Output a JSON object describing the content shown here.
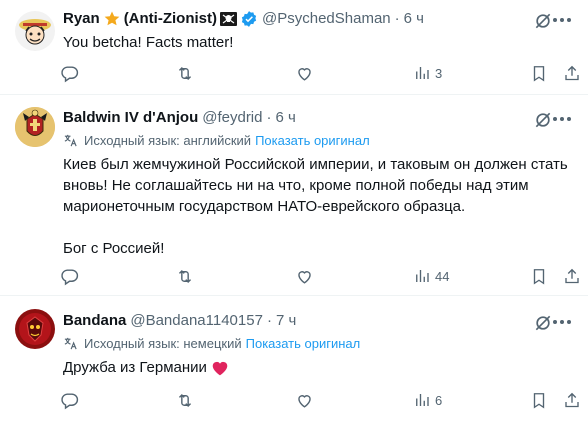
{
  "tweets": [
    {
      "name": "Ryan",
      "name_suffix": "(Anti-Zionist)",
      "handle": "@PsychedShaman",
      "time": "6 ч",
      "body": [
        "You betcha! Facts matter!"
      ],
      "counts": {
        "replies": "",
        "retweets": "",
        "likes": "",
        "views": "3"
      }
    },
    {
      "name": "Baldwin IV d'Anjou",
      "handle": "@feydrid",
      "time": "6 ч",
      "translation_label": "Исходный язык: английский",
      "translation_action": "Показать оригинал",
      "body": [
        "Киев был жемчужиной Российской империи, и таковым он должен стать вновь! Не соглашайтесь ни на что, кроме полной победы над этим марионеточным государством НАТО-еврейского образца.",
        "Бог с Россией!"
      ],
      "counts": {
        "replies": "",
        "retweets": "",
        "likes": "",
        "views": "44"
      }
    },
    {
      "name": "Bandana",
      "handle": "@Bandana1140157",
      "time": "7 ч",
      "translation_label": "Исходный язык: немецкий",
      "translation_action": "Показать оригинал",
      "body": [
        "Дружба из Германии"
      ],
      "counts": {
        "replies": "",
        "retweets": "",
        "likes": "",
        "views": "6"
      }
    }
  ],
  "separator": "·",
  "icons": {
    "reply": "reply-icon",
    "retweet": "retweet-icon",
    "like": "heart-icon",
    "views": "views-icon",
    "bookmark": "bookmark-icon",
    "share": "share-icon",
    "grok": "grok-icon",
    "more": "more-icon",
    "translate": "translate-icon"
  },
  "colors": {
    "text": "#0f1419",
    "secondary": "#536471",
    "link": "#1d9bf0",
    "divider": "#eff3f4",
    "verified": "#1d9bf0",
    "heart": "#e0245e",
    "star": "#f4a91d"
  }
}
